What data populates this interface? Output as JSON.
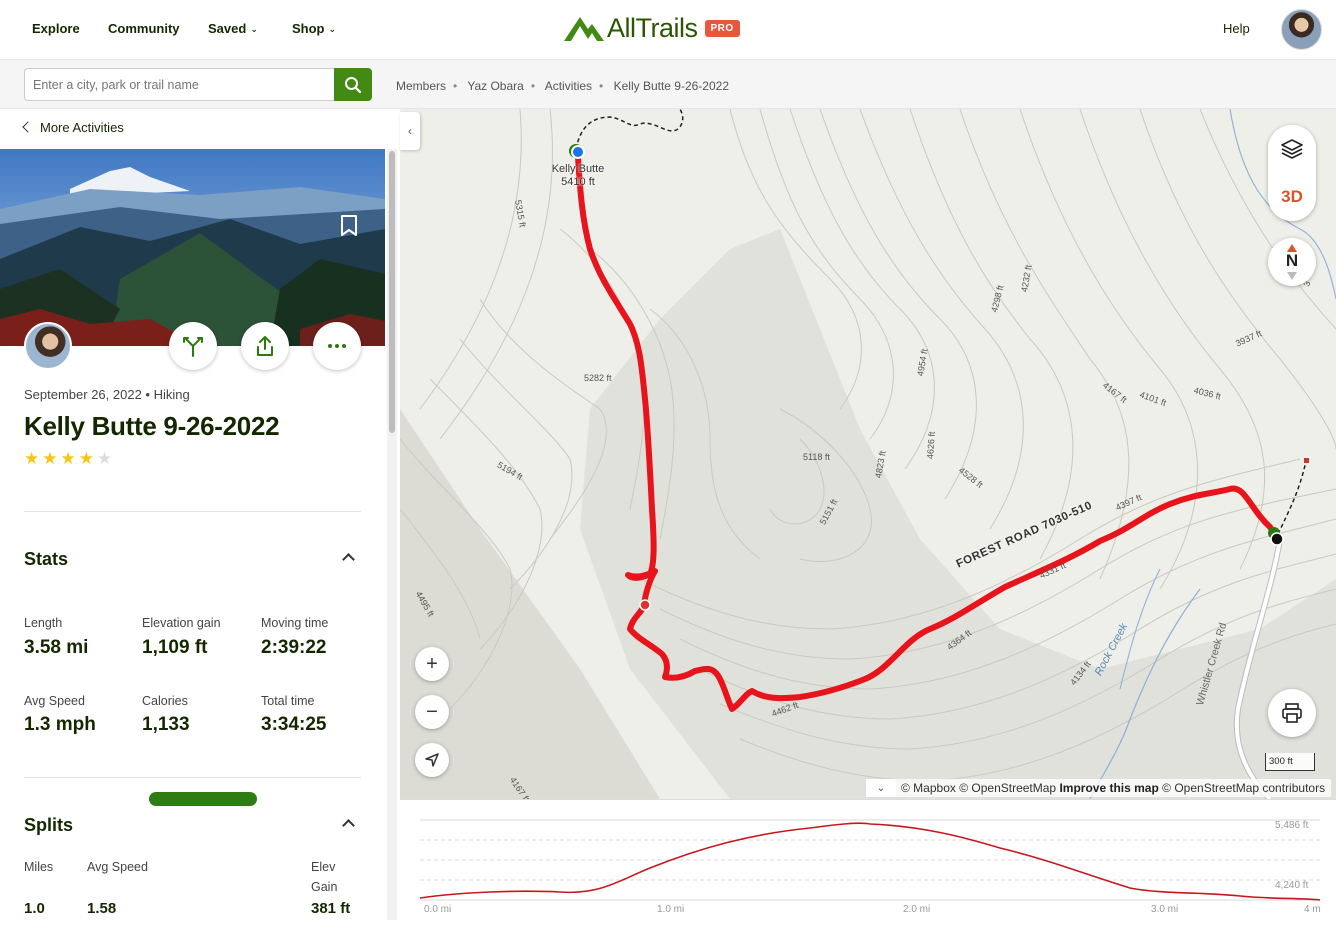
{
  "nav": {
    "left_links": [
      {
        "label": "Explore",
        "dropdown": false
      },
      {
        "label": "Community",
        "dropdown": false
      },
      {
        "label": "Saved",
        "dropdown": true
      },
      {
        "label": "Shop",
        "dropdown": true
      }
    ],
    "brand": "AllTrails",
    "pro_badge": "PRO",
    "help": "Help",
    "colors": {
      "brand_green": "#428a13",
      "pro_orange": "#e8573b",
      "route_red": "#e8141b"
    }
  },
  "search": {
    "placeholder": "Enter a city, park or trail name"
  },
  "breadcrumb": [
    "Members",
    "Yaz Obara",
    "Activities",
    "Kelly Butte 9-26-2022"
  ],
  "sidebar": {
    "back_link": "More Activities",
    "meta": "September 26, 2022 • Hiking",
    "title": "Kelly Butte 9-26-2022",
    "rating": 4,
    "rating_max": 5,
    "stats": {
      "heading": "Stats",
      "items": [
        {
          "label": "Length",
          "value": "3.58 mi"
        },
        {
          "label": "Elevation gain",
          "value": "1,109 ft"
        },
        {
          "label": "Moving time",
          "value": "2:39:22"
        },
        {
          "label": "Avg Speed",
          "value": "1.3 mph"
        },
        {
          "label": "Calories",
          "value": "1,133"
        },
        {
          "label": "Total time",
          "value": "3:34:25"
        }
      ]
    },
    "splits": {
      "heading": "Splits",
      "columns": [
        "Miles",
        "Avg Speed",
        "Elev",
        "Gain"
      ],
      "rows": [
        {
          "miles": "1.0",
          "avg_speed": "1.58",
          "elev_gain": "381 ft"
        }
      ]
    }
  },
  "map": {
    "peak_label": "Kelly Butte",
    "peak_elev": "5410 ft",
    "road_label": "FOREST ROAD 7030-510",
    "road_label_2": "Whistler Creek Rd",
    "creek_label": "Rock Creek",
    "contour_labels": [
      "5315 ft",
      "5282 ft",
      "5194 ft",
      "5118 ft",
      "5151 ft",
      "4954 ft",
      "4823 ft",
      "4626 ft",
      "4528 ft",
      "4298 ft",
      "4232 ft",
      "4167 ft",
      "4101 ft",
      "4036 ft",
      "3937 ft",
      "4397 ft",
      "4331 ft",
      "4364 ft",
      "4462 ft",
      "4495 ft",
      "4167 ft",
      "4134 ft",
      "3"
    ],
    "compass": "N",
    "three_d": "3D",
    "scale": "300 ft",
    "attribution": {
      "mapbox": "© Mapbox",
      "osm": "© OpenStreetMap",
      "improve": "Improve this map",
      "contrib": "© OpenStreetMap contributors"
    }
  },
  "elevation": {
    "max_label": "5,486 ft",
    "min_label": "4,240 ft",
    "x_labels": [
      "0.0 mi",
      "1.0 mi",
      "2.0 mi",
      "3.0 mi",
      "4 m"
    ]
  }
}
